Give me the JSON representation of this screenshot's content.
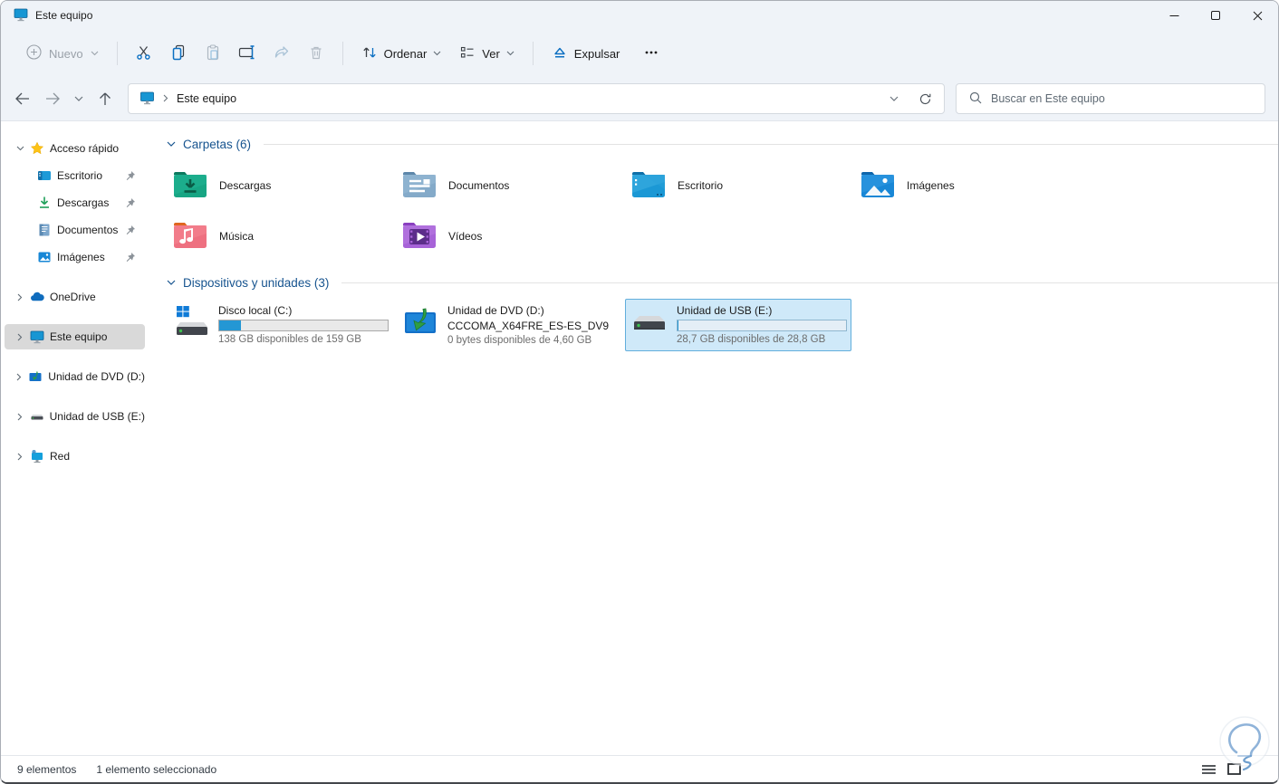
{
  "window": {
    "title": "Este equipo",
    "controls": {
      "minimize": "minimize",
      "maximize": "maximize",
      "close": "close"
    }
  },
  "toolbar": {
    "new_label": "Nuevo",
    "sort_label": "Ordenar",
    "view_label": "Ver",
    "eject_label": "Expulsar"
  },
  "address": {
    "root": "Este equipo"
  },
  "search": {
    "placeholder": "Buscar en Este equipo"
  },
  "sidebar": {
    "items": [
      {
        "label": "Acceso rápido"
      },
      {
        "label": "Escritorio"
      },
      {
        "label": "Descargas"
      },
      {
        "label": "Documentos"
      },
      {
        "label": "Imágenes"
      },
      {
        "label": "OneDrive"
      },
      {
        "label": "Este equipo"
      },
      {
        "label": "Unidad de DVD (D:)"
      },
      {
        "label": "Unidad de USB (E:)"
      },
      {
        "label": "Red"
      }
    ]
  },
  "main": {
    "sections": [
      {
        "title": "Carpetas (6)",
        "folders": [
          {
            "label": "Descargas"
          },
          {
            "label": "Documentos"
          },
          {
            "label": "Escritorio"
          },
          {
            "label": "Imágenes"
          },
          {
            "label": "Música"
          },
          {
            "label": "Vídeos"
          }
        ]
      },
      {
        "title": "Dispositivos y unidades (3)",
        "drives": [
          {
            "name": "Disco local (C:)",
            "free": "138 GB disponibles de 159 GB",
            "bar_fill_style": "width:13%"
          },
          {
            "name": "Unidad de DVD (D:)",
            "name2": "CCCOMA_X64FRE_ES-ES_DV9",
            "free": "0 bytes disponibles de 4,60 GB"
          },
          {
            "name": "Unidad de USB (E:)",
            "free": "28,7 GB disponibles de 28,8 GB",
            "bar_fill_style": "width:0.5%"
          }
        ]
      }
    ]
  },
  "statusbar": {
    "count": "9 elementos",
    "selected": "1 elemento seleccionado"
  },
  "colors": {
    "accent_blue": "#0b6fc2",
    "chrome_bg": "#eff3f8",
    "selection_bg": "#cfe9f9",
    "selection_border": "#62aedc",
    "sidebar_selected_bg": "#d9d9d9",
    "section_title": "#17548f",
    "drive_bar_fill": "#2497d4"
  },
  "icons": [
    "this-pc-icon",
    "new-plus-icon",
    "cut-icon",
    "copy-icon",
    "paste-icon",
    "rename-icon",
    "share-icon",
    "delete-icon",
    "sort-icon",
    "view-icon",
    "eject-icon",
    "more-icon",
    "back-icon",
    "forward-icon",
    "history-chevron-icon",
    "up-icon",
    "refresh-icon",
    "search-icon",
    "star-icon",
    "desktop-icon",
    "downloads-icon",
    "documents-icon",
    "pictures-icon",
    "onedrive-icon",
    "dvd-drive-icon",
    "usb-drive-icon",
    "network-icon",
    "pin-icon",
    "folder-downloads-icon",
    "folder-documents-icon",
    "folder-desktop-icon",
    "folder-pictures-icon",
    "folder-music-icon",
    "folder-videos-icon",
    "hdd-windows-icon",
    "details-view-icon",
    "thumbnail-view-icon",
    "lightbulb-watermark"
  ]
}
